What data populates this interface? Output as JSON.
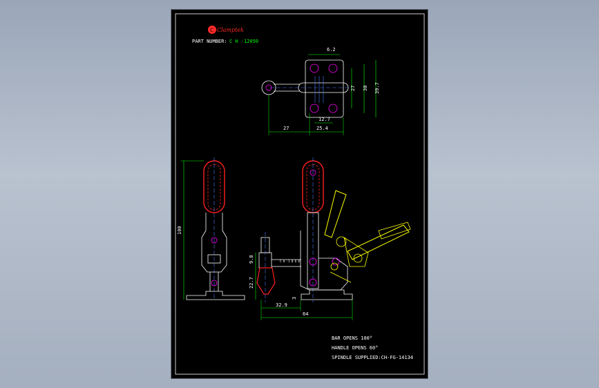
{
  "brand": {
    "name": "Clamptek",
    "logo_mark": "C"
  },
  "part": {
    "label": "PART NUMBER:",
    "number": "C H -12050"
  },
  "top_view": {
    "dims": {
      "d1": "6.2",
      "d2": "27",
      "d3": "30",
      "d4": "39.7",
      "d5": "12.7",
      "d6": "27",
      "d7": "25.4"
    }
  },
  "front_view": {
    "dims": {
      "d1": "100"
    }
  },
  "side_view": {
    "dims": {
      "d1": "9.8",
      "d2": "22.7",
      "d3": "3",
      "d4": "32.9",
      "d5": "64"
    },
    "spindle_tag": "C H -1 0 6 0"
  },
  "notes": [
    "BAR OPENS 100°",
    "HANDLE OPENS 60°",
    "SPINDLE SUPPLIED:CH-FG-14134"
  ],
  "colors": {
    "background": "#000000",
    "outline": "#ffffff",
    "dimension": "#00ff00",
    "grip": "#ff2020",
    "pivot": "#ff00ff",
    "center": "#4d7cff",
    "moved": "#ffff00",
    "logo": "#ff2a2a"
  }
}
